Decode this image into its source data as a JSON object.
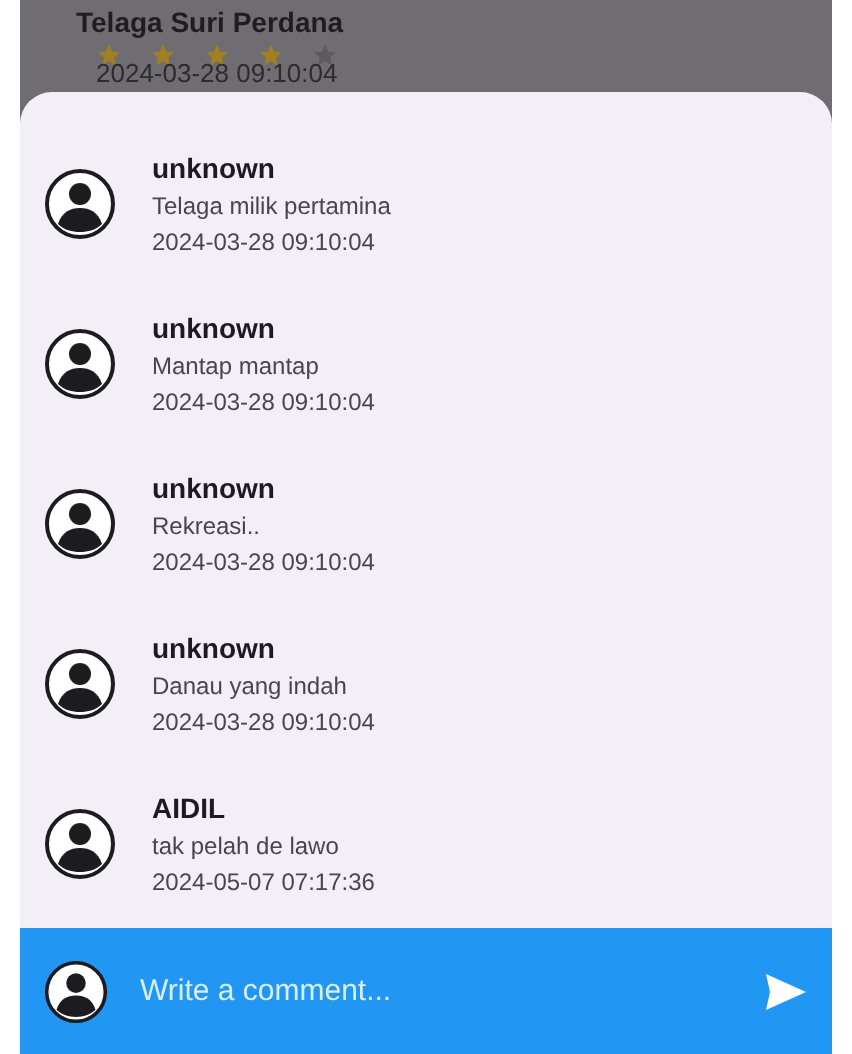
{
  "background": {
    "title": "Telaga Suri Perdana",
    "stars": 4,
    "date": "2024-03-28 09:10:04"
  },
  "comments": [
    {
      "author": "unknown",
      "text": "Telaga milik pertamina",
      "date": "2024-03-28 09:10:04"
    },
    {
      "author": "unknown",
      "text": "Mantap mantap",
      "date": "2024-03-28 09:10:04"
    },
    {
      "author": "unknown",
      "text": "Rekreasi..",
      "date": "2024-03-28 09:10:04"
    },
    {
      "author": "unknown",
      "text": "Danau yang indah",
      "date": "2024-03-28 09:10:04"
    },
    {
      "author": "AIDIL",
      "text": "tak pelah de lawo",
      "date": "2024-05-07 07:17:36"
    }
  ],
  "composer": {
    "placeholder": "Write a comment..."
  }
}
